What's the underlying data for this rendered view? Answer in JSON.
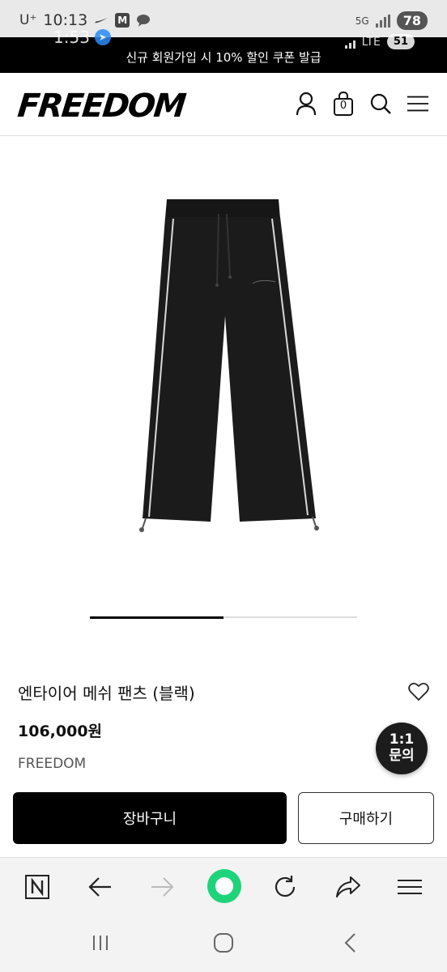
{
  "status_bar": {
    "carrier": "U⁺",
    "time": "10:13",
    "app_badge": "M",
    "network": "5G",
    "battery": "78"
  },
  "overlay": {
    "time": "1:53",
    "network": "LTE",
    "battery": "51"
  },
  "promo": {
    "text": "신규 회원가입 시 10% 할인 쿠폰 발급"
  },
  "header": {
    "logo": "FREEDOM",
    "cart_count": "0",
    "icons": [
      "user-icon",
      "shopping-bag-icon",
      "search-icon",
      "hamburger-menu-icon"
    ]
  },
  "gallery": {
    "slide_progress": 0.5
  },
  "product": {
    "name": "엔타이어 메쉬 팬츠 (블랙)",
    "price": "106,000원",
    "brand": "FREEDOM"
  },
  "chat": {
    "line1": "1:1",
    "line2": "문의"
  },
  "actions": {
    "cart_label": "장바구니",
    "buy_label": "구매하기"
  },
  "browser_toolbar": {
    "icons": [
      "naver-n-icon",
      "back-arrow-icon",
      "forward-arrow-icon",
      "green-home-icon",
      "refresh-icon",
      "share-icon",
      "menu-icon"
    ]
  },
  "system_nav": {
    "icons": [
      "recent-apps-icon",
      "home-icon",
      "back-icon"
    ]
  },
  "colors": {
    "accent_green": "#1ed47a",
    "button_black": "#000000",
    "promo_bg": "#000000"
  }
}
